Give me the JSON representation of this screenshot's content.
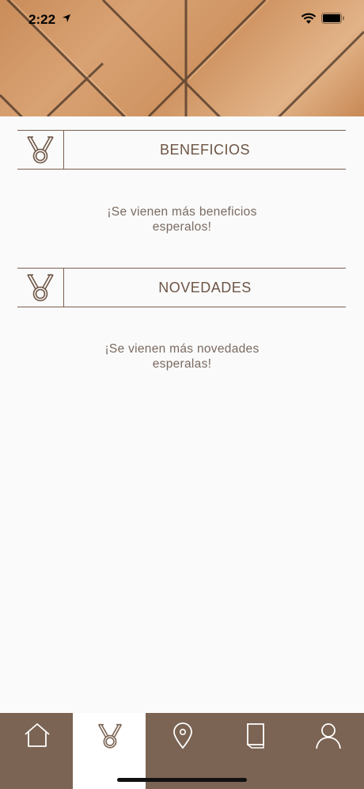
{
  "status_bar": {
    "time": "2:22"
  },
  "sections": [
    {
      "title": "BENEFICIOS",
      "message_line1": "¡Se vienen más beneficios",
      "message_line2": "esperalos!"
    },
    {
      "title": "NOVEDADES",
      "message_line1": "¡Se vienen más novedades",
      "message_line2": "esperalas!"
    }
  ],
  "tabbar": {
    "items": [
      {
        "icon": "home-icon",
        "active": false
      },
      {
        "icon": "medal-icon",
        "active": true
      },
      {
        "icon": "location-pin-icon",
        "active": false
      },
      {
        "icon": "book-icon",
        "active": false
      },
      {
        "icon": "user-icon",
        "active": false
      }
    ]
  },
  "colors": {
    "brand_brown": "#7b6453",
    "text_brown": "#6e5545",
    "background": "#fafafa"
  }
}
